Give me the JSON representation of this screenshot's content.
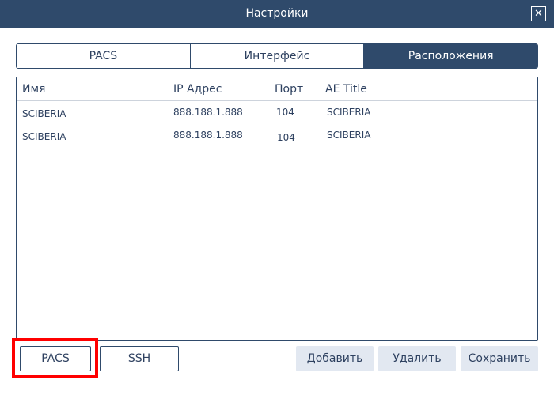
{
  "window": {
    "title": "Настройки",
    "close_symbol": "✕"
  },
  "tabs": [
    {
      "label": "PACS",
      "active": false
    },
    {
      "label": "Интерфейс",
      "active": false
    },
    {
      "label": "Расположения",
      "active": true
    }
  ],
  "table": {
    "headers": [
      "Имя",
      "IP Адрес",
      "Порт",
      "AE Title"
    ],
    "rows": [
      {
        "name": "SCIBERIA",
        "ip": "888.188.1.888",
        "port": "104",
        "ae_title": "SCIBERIA"
      },
      {
        "name": "SCIBERIA",
        "ip": "888.188.1.888",
        "port": "104",
        "ae_title": "SCIBERIA"
      }
    ]
  },
  "buttons": {
    "pacs": "PACS",
    "ssh": "SSH",
    "add": "Добавить",
    "delete": "Удалить",
    "save": "Сохранить"
  },
  "colors": {
    "primary": "#2f4a6b",
    "text": "#2e4160",
    "button_fill": "#e2e8f1",
    "highlight": "#ff0000"
  }
}
